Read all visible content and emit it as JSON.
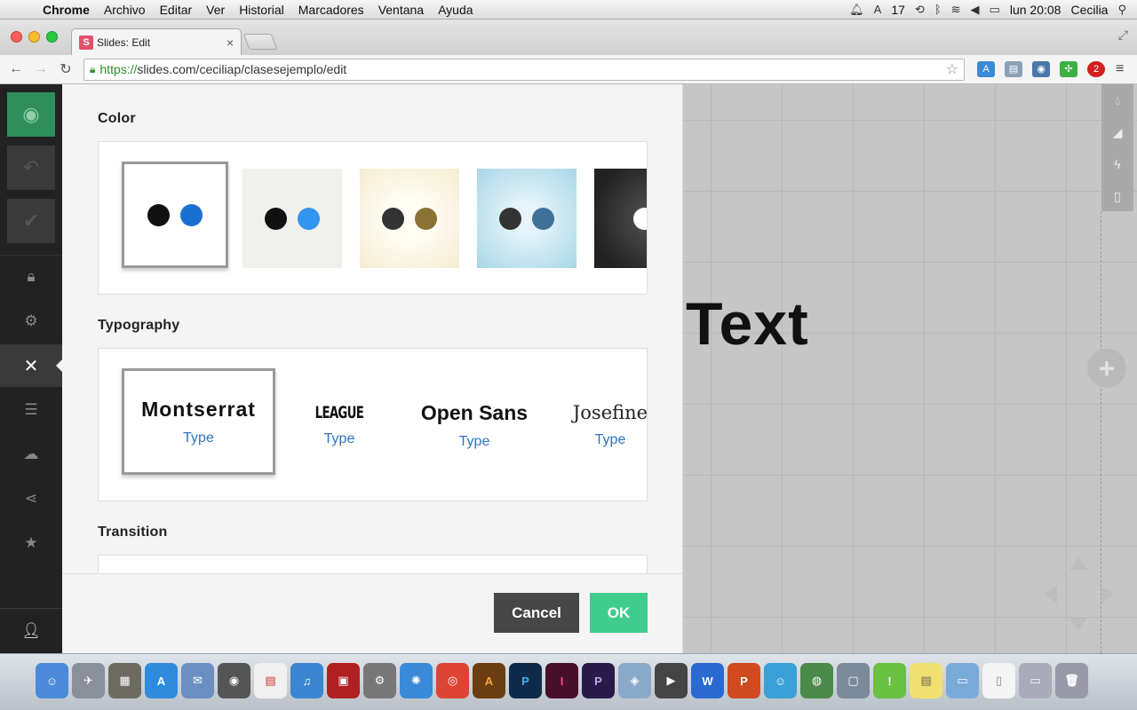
{
  "menubar": {
    "app": "Chrome",
    "menus": [
      "Archivo",
      "Editar",
      "Ver",
      "Historial",
      "Marcadores",
      "Ventana",
      "Ayuda"
    ],
    "status": {
      "notif_count": "17",
      "clock": "lun 20:08",
      "user": "Cecilia"
    }
  },
  "tab": {
    "favicon": "S",
    "title": "Slides: Edit",
    "close": "×"
  },
  "toolbar": {
    "url_scheme": "https://",
    "url_rest": "slides.com/ceciliap/clasesejemplo/edit",
    "extension_badge": "2"
  },
  "sidebar": {
    "icons": [
      "eye-icon",
      "undo-icon",
      "checkmark-icon",
      "lock-icon",
      "gear-icon",
      "close-icon",
      "layers-icon",
      "cloud-icon",
      "share-icon",
      "star-icon",
      "user-icon"
    ]
  },
  "panel": {
    "color_title": "Color",
    "typography_title": "Typography",
    "transition_title": "Transition",
    "color_swatches": [
      {
        "dots": [
          "#111111",
          "#1a6fd1"
        ],
        "selected": true
      },
      {
        "dots": [
          "#111111",
          "#3394f0"
        ],
        "selected": false
      },
      {
        "dots": [
          "#333333",
          "#8a7236"
        ],
        "selected": false
      },
      {
        "dots": [
          "#333333",
          "#3e7099"
        ],
        "selected": false
      },
      {
        "dots": [
          "#ffffff"
        ],
        "selected": false
      }
    ],
    "typefaces": [
      {
        "name": "Montserrat",
        "label": "Type",
        "selected": true
      },
      {
        "name": "LEAGUE",
        "label": "Type",
        "selected": false
      },
      {
        "name": "Open Sans",
        "label": "Type",
        "selected": false
      },
      {
        "name": "Josefine",
        "label": "Type",
        "selected": false
      }
    ],
    "cancel_label": "Cancel",
    "ok_label": "OK"
  },
  "canvas": {
    "slide_text": "Text"
  },
  "colors": {
    "accent_green": "#3fcc8c",
    "sidebar_bg": "#222222",
    "link_blue": "#2d74bf"
  }
}
